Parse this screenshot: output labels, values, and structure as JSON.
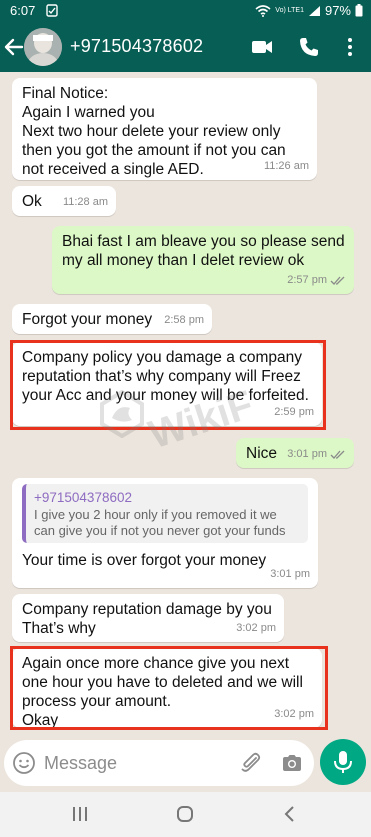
{
  "status_bar": {
    "time": "6:07",
    "network": "Vo) LTE1",
    "battery": "97%"
  },
  "header": {
    "contact_name": "+971504378602"
  },
  "messages": [
    {
      "direction": "in",
      "text": "Final Notice:\nAgain I warned you\nNext two hour delete your review only then you got the amount if not you can not received a single AED.",
      "time": "11:26 am"
    },
    {
      "direction": "in",
      "text": "Ok",
      "time": "11:28 am"
    },
    {
      "direction": "out",
      "text": "Bhai fast I am  bleave you so please send my all money than I delet review ok",
      "time": "2:57 pm"
    },
    {
      "direction": "in",
      "text": "Forgot your money",
      "time": "2:58 pm"
    },
    {
      "direction": "in",
      "text": "Company policy you damage a company reputation that’s why company will Freez your Acc and your money will be forfeited.",
      "time": "2:59 pm",
      "highlighted": true
    },
    {
      "direction": "out",
      "text": "Nice",
      "time": "3:01 pm"
    },
    {
      "direction": "in",
      "quote": {
        "name": "+971504378602",
        "text": "I give you 2 hour only if you removed it we can give you if not you never got your funds"
      },
      "text": "Your time is over forgot your money",
      "time": "3:01 pm"
    },
    {
      "direction": "in",
      "text": "Company reputation damage by you\nThat’s why",
      "time": "3:02 pm"
    },
    {
      "direction": "in",
      "text": "Again once more chance give you next one hour you have to deleted and we will process your amount.\nOkay",
      "time": "3:02 pm",
      "highlighted": true
    }
  ],
  "watermark": {
    "text": "WikiF"
  },
  "composer": {
    "placeholder": "Message"
  },
  "colors": {
    "header": "#075e54",
    "incoming_bubble": "#ffffff",
    "outgoing_bubble": "#dcf8c6",
    "highlight_box": "#e8321e",
    "mic_button": "#00a884",
    "read_ticks": "#8a8a8a"
  },
  "icons": {
    "back": "arrow-left-icon",
    "video_call": "video-camera-icon",
    "voice_call": "phone-icon",
    "menu": "more-vertical-icon",
    "emoji": "smiley-icon",
    "attach": "paperclip-icon",
    "camera": "camera-icon",
    "mic": "microphone-icon"
  }
}
